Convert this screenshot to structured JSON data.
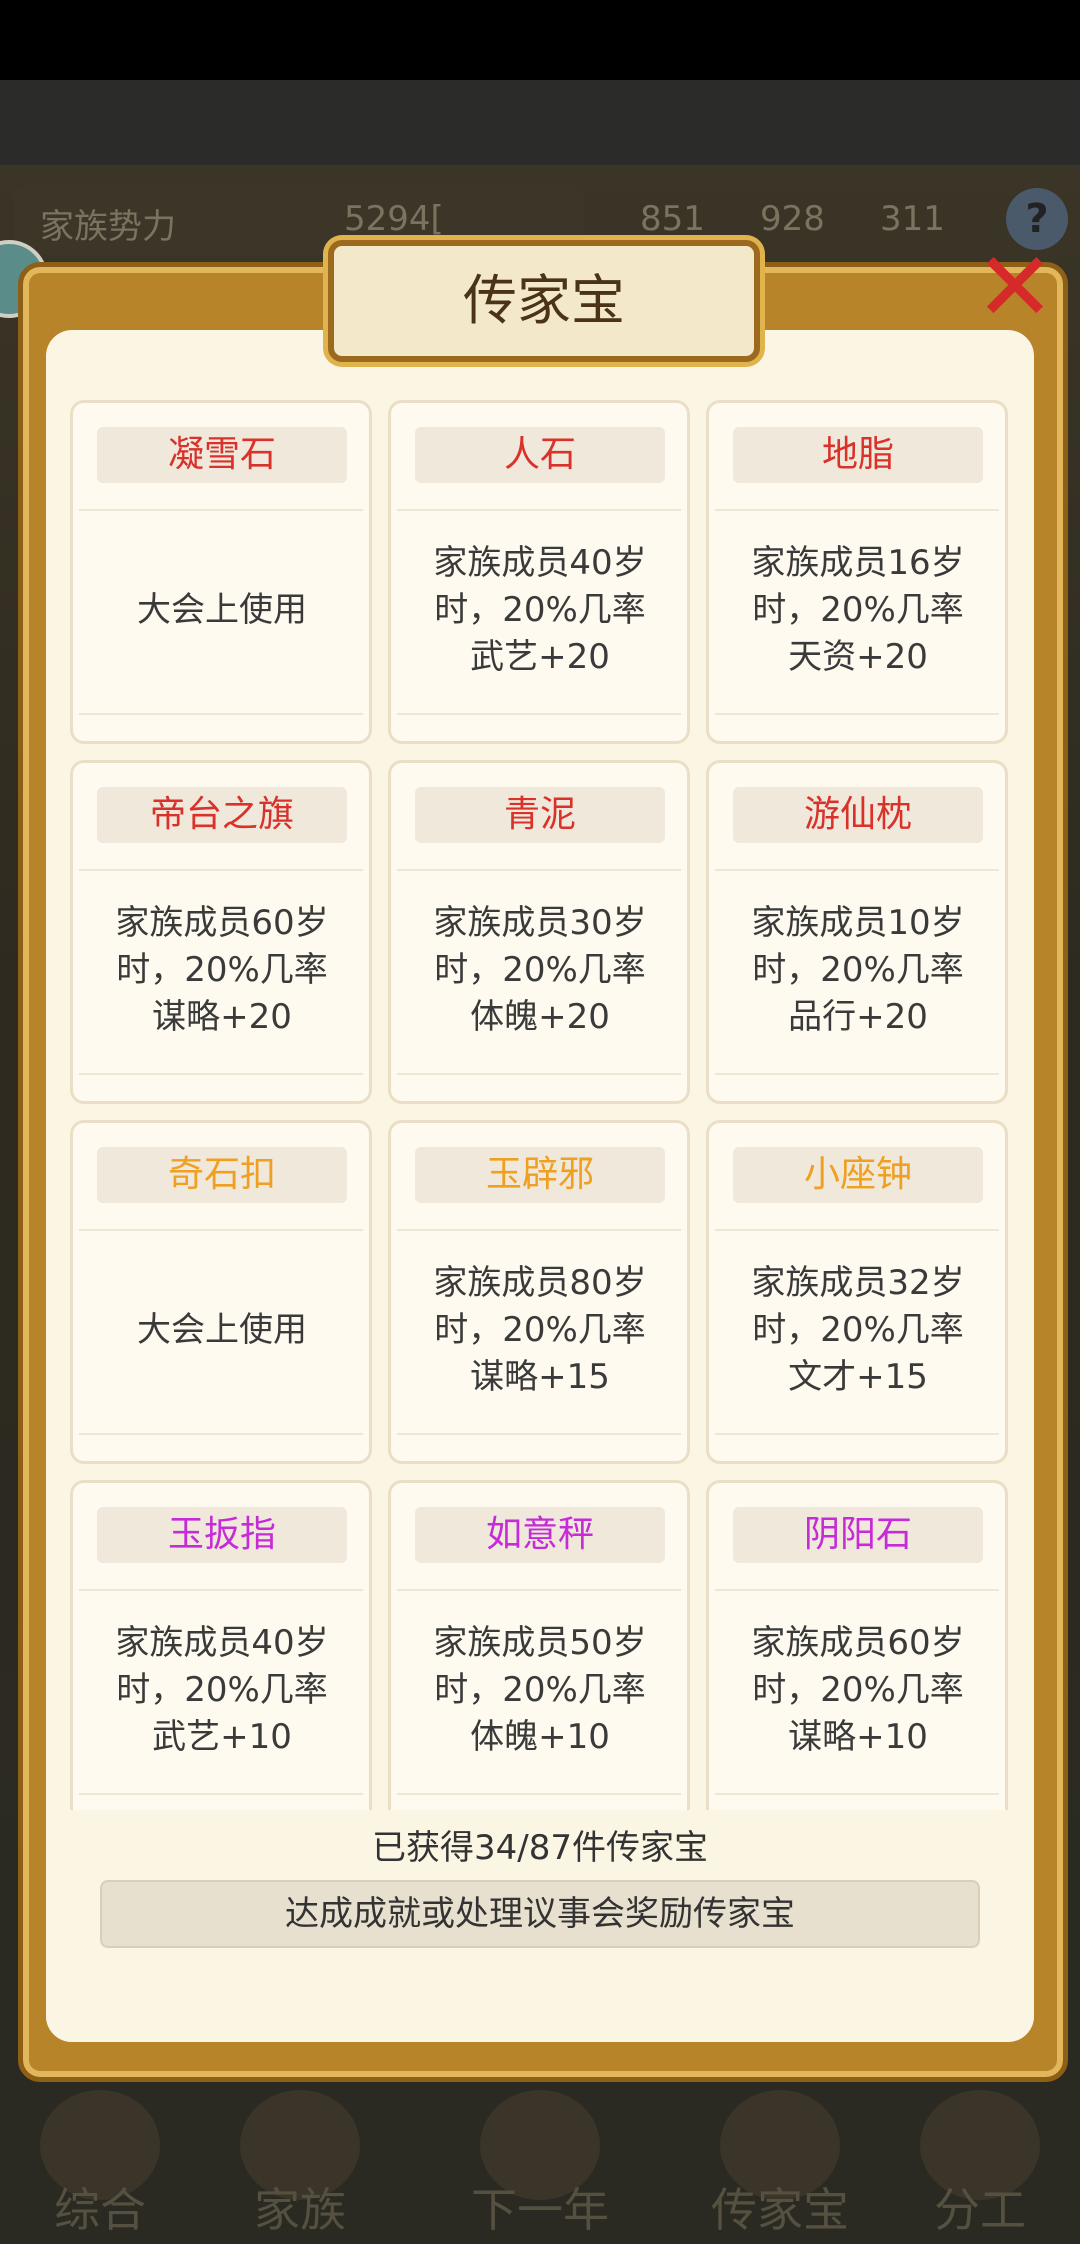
{
  "background": {
    "power_label": "家族势力",
    "power_value": "5294[",
    "resources": [
      "851",
      "928",
      "311"
    ]
  },
  "modal": {
    "title": "传家宝",
    "close_symbol": "✕"
  },
  "heirlooms": [
    {
      "name": "凝雪石",
      "color": "#d8322a",
      "desc": "大会上使用"
    },
    {
      "name": "人石",
      "color": "#d8322a",
      "desc": "家族成员40岁\n时，20%几率\n武艺+20"
    },
    {
      "name": "地脂",
      "color": "#d8322a",
      "desc": "家族成员16岁\n时，20%几率\n天资+20"
    },
    {
      "name": "帝台之旗",
      "color": "#d8322a",
      "desc": "家族成员60岁\n时，20%几率\n谋略+20"
    },
    {
      "name": "青泥",
      "color": "#d8322a",
      "desc": "家族成员30岁\n时，20%几率\n体魄+20"
    },
    {
      "name": "游仙枕",
      "color": "#d8322a",
      "desc": "家族成员10岁\n时，20%几率\n品行+20"
    },
    {
      "name": "奇石扣",
      "color": "#f0a020",
      "desc": "大会上使用"
    },
    {
      "name": "玉辟邪",
      "color": "#f0a020",
      "desc": "家族成员80岁\n时，20%几率\n谋略+15"
    },
    {
      "name": "小座钟",
      "color": "#f0a020",
      "desc": "家族成员32岁\n时，20%几率\n文才+15"
    },
    {
      "name": "玉扳指",
      "color": "#c52bd6",
      "desc": "家族成员40岁\n时，20%几率\n武艺+10"
    },
    {
      "name": "如意秤",
      "color": "#c52bd6",
      "desc": "家族成员50岁\n时，20%几率\n体魄+10"
    },
    {
      "name": "阴阳石",
      "color": "#c52bd6",
      "desc": "家族成员60岁\n时，20%几率\n谋略+10"
    }
  ],
  "footer": {
    "count_text": "已获得34/87件传家宝",
    "info_button": "达成成就或处理议事会奖励传家宝"
  },
  "bottom_nav": [
    "综合",
    "家族",
    "下一年",
    "传家宝",
    "分工"
  ]
}
